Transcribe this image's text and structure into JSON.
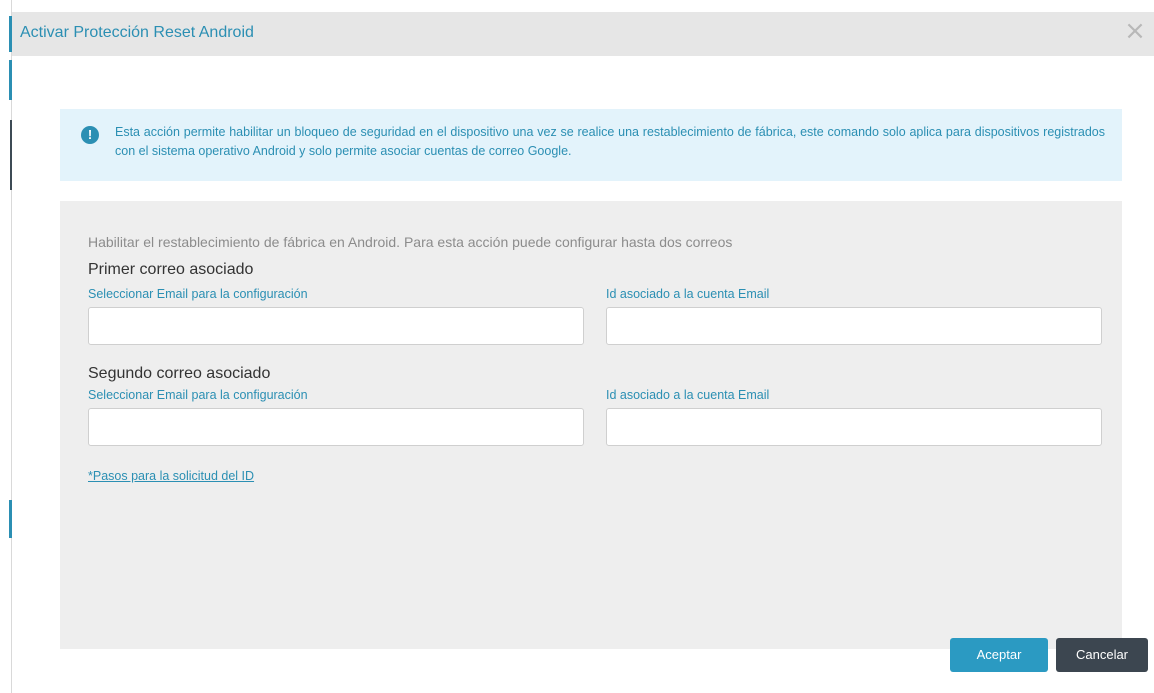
{
  "dialog": {
    "title": "Activar Protección Reset Android",
    "close_symbol": "×"
  },
  "info": {
    "icon": "alert-icon",
    "icon_glyph": "!",
    "text": "Esta acción permite habilitar un bloqueo de seguridad en el dispositivo una vez se realice una restablecimiento de fábrica, este comando solo aplica para dispositivos registrados con el sistema operativo Android y solo permite asociar cuentas de correo Google."
  },
  "form": {
    "intro": "Habilitar el restablecimiento de fábrica en Android. Para esta acción puede configurar hasta dos correos",
    "first": {
      "title": "Primer correo asociado",
      "email_label": "Seleccionar Email para la configuración",
      "email_value": "",
      "id_label": "Id asociado a la cuenta Email",
      "id_value": ""
    },
    "second": {
      "title": "Segundo correo asociado",
      "email_label": "Seleccionar Email para la configuración",
      "email_value": "",
      "id_label": "Id asociado a la cuenta Email",
      "id_value": ""
    },
    "help_link": "*Pasos para la solicitud del ID"
  },
  "buttons": {
    "accept": "Aceptar",
    "cancel": "Cancelar"
  },
  "colors": {
    "accent": "#2b8fb3",
    "accept_button": "#2b9ac2",
    "cancel_button": "#3c4650",
    "info_background": "#e3f3fb",
    "panel_background": "#eeeeee"
  }
}
